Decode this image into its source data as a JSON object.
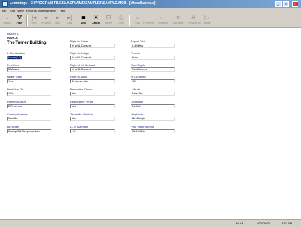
{
  "window": {
    "title": "Lemmings - C:\\PROGRAM FILES\\LASTNAME\\SAMPLES\\SAMPLE.MDB - [Miscellaneous]",
    "min": "_",
    "max": "□",
    "close": "×"
  },
  "menu": [
    "File",
    "Edit",
    "View",
    "Records",
    "Administration",
    "Help"
  ],
  "toolbar": [
    {
      "label": "Search",
      "icon": "search-icon",
      "glyph": "⌕",
      "active": false
    },
    {
      "label": "Filter",
      "icon": "filter-icon",
      "glyph": "∇",
      "active": true
    },
    {
      "label": "First",
      "icon": "first-icon",
      "glyph": "|◂",
      "active": false
    },
    {
      "label": "Previous",
      "icon": "previous-icon",
      "glyph": "◂",
      "active": false
    },
    {
      "label": "Next",
      "icon": "next-icon",
      "glyph": "▸",
      "active": false
    },
    {
      "label": "Last",
      "icon": "last-icon",
      "glyph": "▸|",
      "active": false
    },
    {
      "label": "Save",
      "icon": "save-icon",
      "glyph": "■",
      "active": true
    },
    {
      "label": "Cancel",
      "icon": "cancel-icon",
      "glyph": "✕",
      "active": true
    },
    {
      "label": "Delete",
      "icon": "delete-icon",
      "glyph": "⊟",
      "active": false
    },
    {
      "label": "Print",
      "icon": "print-icon",
      "glyph": "⎙",
      "active": false
    },
    {
      "label": "Find",
      "icon": "find-icon",
      "glyph": "⌕",
      "active": false
    },
    {
      "label": "Properties",
      "icon": "properties-icon",
      "glyph": "…",
      "active": false
    },
    {
      "label": "Template",
      "icon": "template-icon",
      "glyph": "▭",
      "active": false
    },
    {
      "label": "Calculate",
      "icon": "calculate-icon",
      "glyph": "≡",
      "active": false
    },
    {
      "label": "Rename By",
      "icon": "rename-icon",
      "glyph": "A",
      "active": false
    },
    {
      "label": "Assign",
      "icon": "assign-icon",
      "glyph": "▷",
      "active": false
    }
  ],
  "record": {
    "label": "Record ID",
    "id": "00001A",
    "name": "The Turner Building"
  },
  "columns": [
    [
      {
        "label": "L. Certification",
        "value": "Good (3.7)",
        "selected": true
      },
      {
        "label": "Free Rent",
        "value": "3 Months"
      },
      {
        "label": "Health Club",
        "value": "Yes"
      },
      {
        "label": "Rent Over To",
        "value": "10%"
      },
      {
        "label": "Parking Spaces",
        "value": "2 Reserved"
      },
      {
        "label": "Communications",
        "value": "Satellite"
      },
      {
        "label": "Bill Broker",
        "value": "Cushgell & Sleepmountain"
      }
    ],
    [
      {
        "label": "Right to Sublet",
        "value": "Yr w/LL Consent"
      },
      {
        "label": "Right to Assign",
        "value": "Yr w/LL Consent"
      },
      {
        "label": "Right of 1st Refusal",
        "value": "Yr w/LL Consent"
      },
      {
        "label": "Right to Audit",
        "value": "30 days notice"
      },
      {
        "label": "Relocation Clause",
        "value": "Yes"
      },
      {
        "label": "Restoration Permit",
        "value": "Yes"
      },
      {
        "label": "Tenant to Maintain",
        "value": "Yes"
      },
      {
        "label": "LL to Maintain",
        "value": "HH"
      }
    ],
    [
      {
        "label": "Airport Dist.",
        "value": "8.4 Miles"
      },
      {
        "label": "Fitness",
        "value": "Point"
      },
      {
        "label": "Roof Rights",
        "value": "Roof Access"
      },
      {
        "label": "% Occupied",
        "value": "100"
      },
      {
        "label": "Latitude",
        "value": "Bala, Tel"
      },
      {
        "label": "Longitude",
        "value": "Dir-Mile"
      },
      {
        "label": "Neighbors",
        "value": "Mr. Albright"
      },
      {
        "label": "Post Year Revenue",
        "value": "$6.4 Million"
      }
    ]
  ],
  "status": {
    "mode": "NUM",
    "date": "4/25/2005",
    "time": "3:37 PM"
  }
}
